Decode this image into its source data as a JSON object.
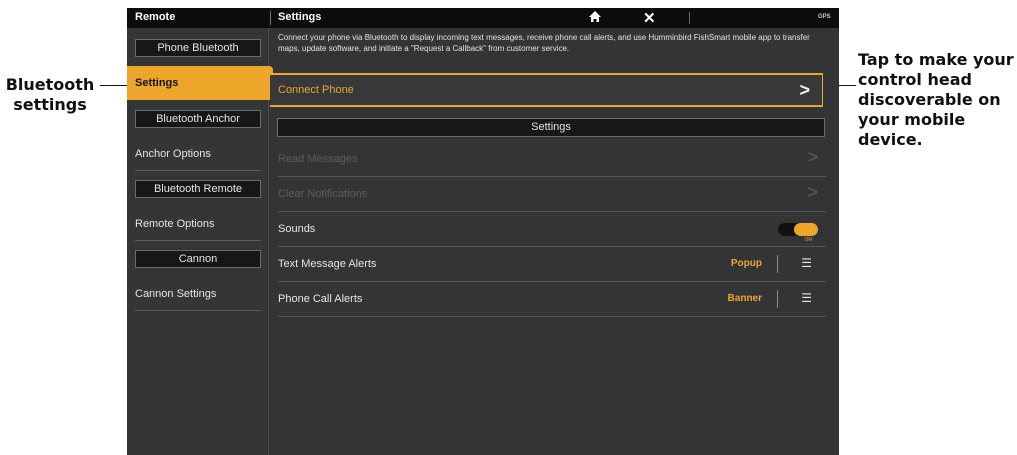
{
  "callouts": {
    "left": "Bluetooth settings",
    "right": "Tap to make your control head discoverable on your mobile device."
  },
  "topbar": {
    "left_title": "Remote",
    "right_title": "Settings",
    "home_icon": "home-icon",
    "close_icon": "close-icon",
    "status": "GPS"
  },
  "sidebar": {
    "sections": [
      {
        "header": "Phone Bluetooth",
        "item": "Settings",
        "active": true
      },
      {
        "header": "Bluetooth Anchor",
        "item": "Anchor Options",
        "active": false
      },
      {
        "header": "Bluetooth Remote",
        "item": "Remote Options",
        "active": false
      },
      {
        "header": "Cannon",
        "item": "Cannon Settings",
        "active": false
      }
    ]
  },
  "main": {
    "intro": "Connect your phone via Bluetooth to display incoming text messages, receive phone call alerts, and use Humminbird FishSmart mobile app to transfer maps, update software, and initiate a \"Request a Callback\" from customer service.",
    "connect_phone": "Connect Phone",
    "section_title": "Settings",
    "rows": [
      {
        "label": "Read Messages",
        "disabled": true
      },
      {
        "label": "Clear Notifications",
        "disabled": true
      },
      {
        "label": "Sounds",
        "toggle_on": true,
        "toggle_text": "ON"
      },
      {
        "label": "Text Message Alerts",
        "value": "Popup"
      },
      {
        "label": "Phone Call Alerts",
        "value": "Banner"
      }
    ],
    "chevron": ">"
  },
  "colors": {
    "accent": "#eea62a",
    "background": "#333436",
    "topbar": "#0c0c0c"
  }
}
